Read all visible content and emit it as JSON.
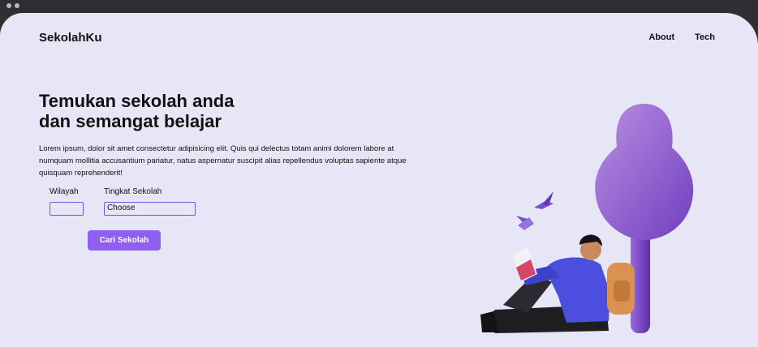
{
  "header": {
    "brand": "SekolahKu",
    "nav": [
      {
        "label": "About"
      },
      {
        "label": "Tech"
      }
    ]
  },
  "hero": {
    "title_line1": "Temukan sekolah anda",
    "title_line2": "dan semangat belajar",
    "description": "Lorem ipsum, dolor sit amet consectetur adipisicing elit. Quis qui delectus totam animi dolorem labore at numquam mollitia accusantium pariatur, natus aspernatur suscipit alias repellendus voluptas sapiente atque quisquam reprehenderit!"
  },
  "form": {
    "wilayah_label": "Wilayah",
    "wilayah_value": "",
    "tingkat_label": "Tingkat Sekolah",
    "tingkat_selected": "Choose",
    "submit_label": "Cari Sekolah"
  },
  "colors": {
    "background": "#e6e6f6",
    "accent": "#8e5ff0",
    "input_border": "#7a55e0",
    "window_bar": "#2f2f33"
  },
  "illustration": {
    "icons": [
      "tree-icon",
      "person-reading-icon",
      "book-icon",
      "backpack-icon",
      "bird-icon"
    ]
  }
}
